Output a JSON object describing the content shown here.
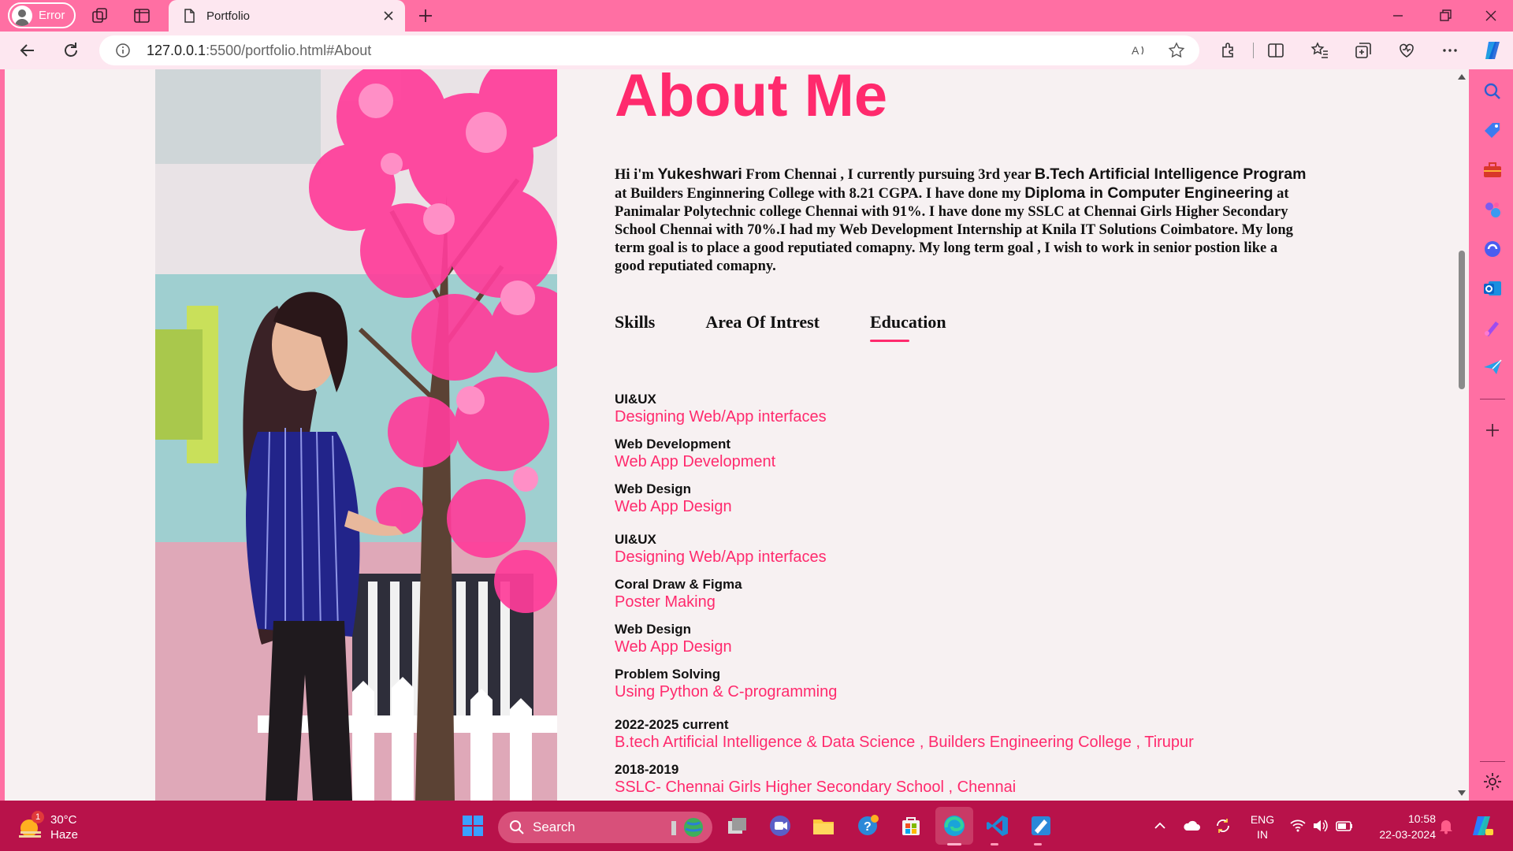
{
  "browser": {
    "profile_status": "Error",
    "tab_title": "Portfolio",
    "url_host": "127.0.0.1",
    "url_rest": ":5500/portfolio.html#About"
  },
  "page": {
    "heading": "About Me",
    "intro": {
      "t1": "Hi i'm ",
      "name": "Yukeshwari",
      "t2": " From Chennai , I currently pursuing 3rd year ",
      "degree": "B.Tech Artificial Intelligence Program",
      "t3": " at Builders Enginnering College with 8.21 CGPA. I have done my ",
      "diploma": "Diploma in Computer Engineering",
      "t4": " at Panimalar Polytechnic college Chennai with 91%. I have done my SSLC at Chennai Girls Higher Secondary School Chennai with 70%.I had my Web Development Internship at Knila IT Solutions Coimbatore. My long term goal is to place a good reputiated comapny. My long term goal , I wish to work in senior postion like a good reputiated comapny."
    },
    "tabs": [
      "Skills",
      "Area Of Intrest",
      "Education"
    ],
    "active_tab": "Education",
    "skills": [
      {
        "title": "UI&UX",
        "desc": "Designing Web/App interfaces"
      },
      {
        "title": "Web Development",
        "desc": "Web App Development"
      },
      {
        "title": "Web Design",
        "desc": "Web App Design"
      }
    ],
    "interests": [
      {
        "title": "UI&UX",
        "desc": "Designing Web/App interfaces"
      },
      {
        "title": "Coral Draw & Figma",
        "desc": "Poster Making"
      },
      {
        "title": "Web Design",
        "desc": "Web App Design"
      },
      {
        "title": "Problem Solving",
        "desc": "Using Python & C-programming"
      }
    ],
    "education": [
      {
        "title": "2022-2025 current",
        "desc": "B.tech Artificial Intelligence & Data Science , Builders Engineering College , Tirupur"
      },
      {
        "title": "2018-2019",
        "desc": "SSLC- Chennai Girls Higher Secondary School , Chennai"
      }
    ]
  },
  "taskbar": {
    "weather_temp": "30°C",
    "weather_desc": "Haze",
    "weather_badge": "1",
    "search_placeholder": "Search",
    "lang_top": "ENG",
    "lang_bottom": "IN",
    "time": "10:58",
    "date": "22-03-2024"
  },
  "colors": {
    "accent": "#ff2a6d",
    "chrome": "#ff6fa3",
    "taskbar": "#b8124a",
    "page_bg": "#f7f1f2"
  }
}
